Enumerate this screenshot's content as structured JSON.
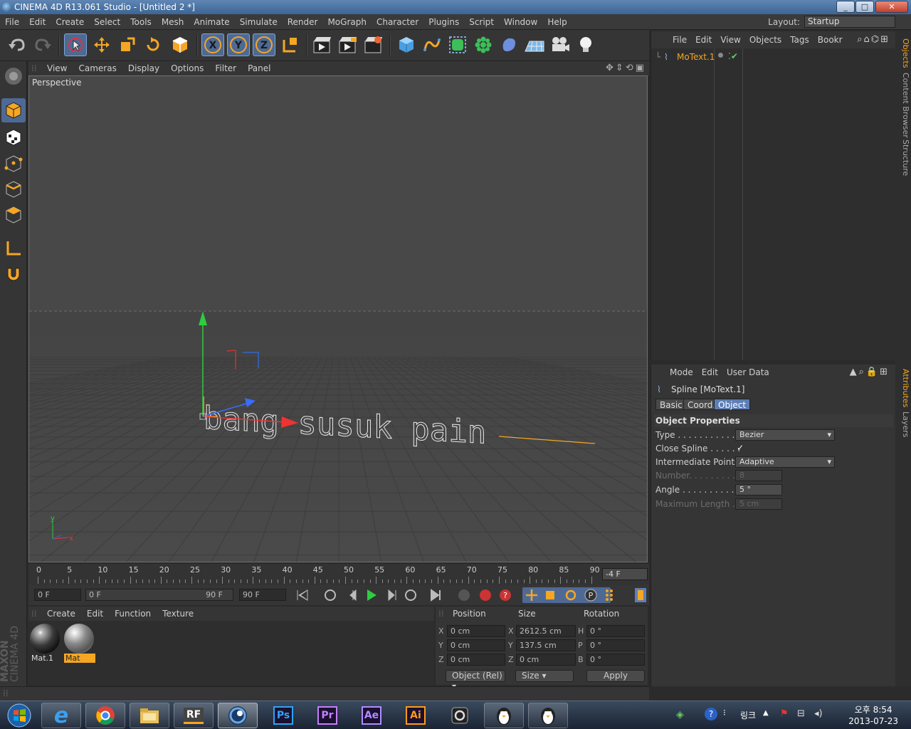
{
  "window": {
    "title": "CINEMA 4D R13.061 Studio - [Untitled 2 *]",
    "controls": [
      "_",
      "□",
      "✕"
    ]
  },
  "menubar": {
    "items": [
      "File",
      "Edit",
      "Create",
      "Select",
      "Tools",
      "Mesh",
      "Animate",
      "Simulate",
      "Render",
      "MoGraph",
      "Character",
      "Plugins",
      "Script",
      "Window",
      "Help"
    ],
    "layout_label": "Layout:",
    "layout_value": "Startup"
  },
  "toolbar": {
    "axis_x": "X",
    "axis_y": "Y",
    "axis_z": "Z"
  },
  "viewport": {
    "menu": [
      "View",
      "Cameras",
      "Display",
      "Options",
      "Filter",
      "Panel"
    ],
    "label": "Perspective",
    "text_object": "bang susuk pain",
    "axis_x": "x",
    "axis_y": "y"
  },
  "timeline": {
    "ticks": [
      "0",
      "5",
      "10",
      "15",
      "20",
      "25",
      "30",
      "35",
      "40",
      "45",
      "50",
      "55",
      "60",
      "65",
      "70",
      "75",
      "80",
      "85",
      "90"
    ],
    "current_frame": "-4 F",
    "start": "0 F",
    "slider_start": "0 F",
    "slider_end": "90 F",
    "end": "90 F"
  },
  "materials": {
    "menu": [
      "Create",
      "Edit",
      "Function",
      "Texture"
    ],
    "items": [
      {
        "name": "Mat.1",
        "selected": false
      },
      {
        "name": "Mat",
        "selected": true
      }
    ]
  },
  "coordinates": {
    "headers": [
      "Position",
      "Size",
      "Rotation"
    ],
    "rows": [
      {
        "axis": "X",
        "pos": "0 cm",
        "size_axis": "X",
        "size": "2612.5 cm",
        "rot_axis": "H",
        "rot": "0 °"
      },
      {
        "axis": "Y",
        "pos": "0 cm",
        "size_axis": "Y",
        "size": "137.5 cm",
        "rot_axis": "P",
        "rot": "0 °"
      },
      {
        "axis": "Z",
        "pos": "0 cm",
        "size_axis": "Z",
        "size": "0 cm",
        "rot_axis": "B",
        "rot": "0 °"
      }
    ],
    "mode": "Object (Rel)",
    "size_mode": "Size",
    "apply": "Apply"
  },
  "maxon_logo": {
    "line1": "MAXON",
    "line2": "CINEMA 4D"
  },
  "objects": {
    "menu": [
      "File",
      "Edit",
      "View",
      "Objects",
      "Tags",
      "Bookr"
    ],
    "items": [
      {
        "name": "MoText.1"
      }
    ]
  },
  "attributes": {
    "menu": [
      "Mode",
      "Edit",
      "User Data"
    ],
    "title": "Spline [MoText.1]",
    "tabs": [
      "Basic",
      "Coord.",
      "Object"
    ],
    "active_tab": "Object",
    "section": "Object Properties",
    "props": [
      {
        "label": "Type . . . . . . . . . . . . .",
        "value": "Bezier",
        "dropdown": true,
        "enabled": true
      },
      {
        "label": "Close Spline . . . . . .",
        "value": "✓",
        "checkbox": true,
        "enabled": true
      },
      {
        "label": "Intermediate Points",
        "value": "Adaptive",
        "dropdown": true,
        "enabled": true
      },
      {
        "label": "Number. . . . . . . . . . .",
        "value": "8",
        "enabled": false
      },
      {
        "label": "Angle . . . . . . . . . . . . .",
        "value": "5 °",
        "enabled": true
      },
      {
        "label": "Maximum Length . .",
        "value": "5 cm",
        "enabled": false
      }
    ]
  },
  "side_tabs": {
    "top": [
      "Objects",
      "Content Browser",
      "Structure"
    ],
    "bottom": [
      "Attributes",
      "Layers"
    ]
  },
  "taskbar": {
    "lang": "링크",
    "time": "오후 8:54",
    "date": "2013-07-23",
    "apps": [
      "Ps",
      "Pr",
      "Ae",
      "Ai"
    ],
    "colors": {
      "Ps": "#2fa3f7",
      "Pr": "#c77dff",
      "Ae": "#b08cff",
      "Ai": "#ff9a1a"
    }
  }
}
